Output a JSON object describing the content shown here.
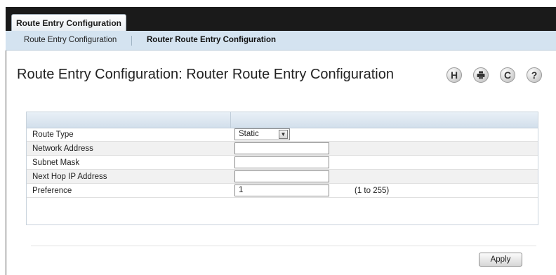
{
  "top_tab": {
    "label": "Route Entry Configuration"
  },
  "sub_nav": {
    "items": [
      {
        "label": "Route Entry Configuration",
        "active": false
      },
      {
        "label": "Router Route Entry Configuration",
        "active": true
      }
    ]
  },
  "page": {
    "title": "Route Entry Configuration: Router Route Entry Configuration"
  },
  "toolbar": {
    "save_icon": "save-icon",
    "print_icon": "print-icon",
    "refresh_icon": "refresh-icon",
    "help_icon": "help-icon",
    "save_glyph": "H",
    "refresh_glyph": "C",
    "help_glyph": "?"
  },
  "form": {
    "rows": [
      {
        "label": "Route Type",
        "value": "Static",
        "control": "select"
      },
      {
        "label": "Network Address",
        "value": "",
        "control": "text"
      },
      {
        "label": "Subnet Mask",
        "value": "",
        "control": "text"
      },
      {
        "label": "Next Hop IP Address",
        "value": "",
        "control": "text"
      },
      {
        "label": "Preference",
        "value": "1",
        "control": "text",
        "hint": "(1 to 255)"
      }
    ]
  },
  "actions": {
    "apply_label": "Apply"
  },
  "colors": {
    "topbar": "#1a1a1a",
    "subnav_bg": "#d4e3f0",
    "panel_header": "#d2dfeb",
    "alt_row": "#f1f1f1"
  }
}
